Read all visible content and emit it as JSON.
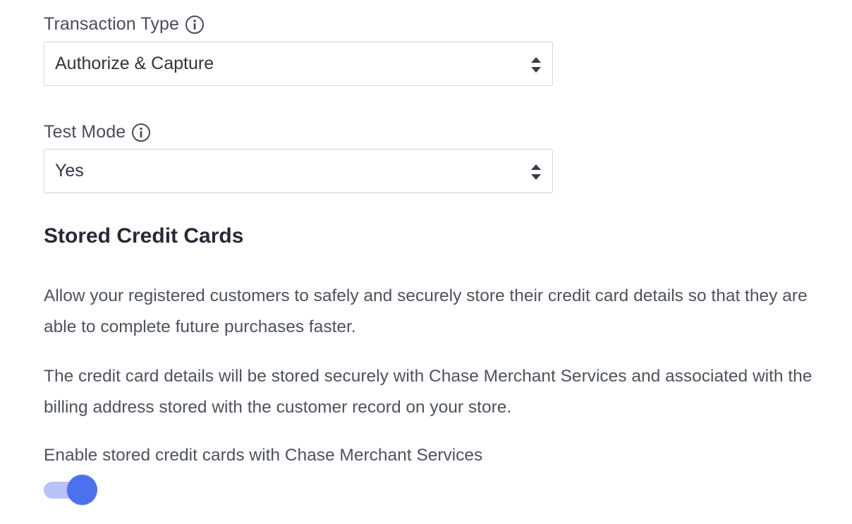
{
  "transaction_type": {
    "label": "Transaction Type",
    "selected": "Authorize & Capture"
  },
  "test_mode": {
    "label": "Test Mode",
    "selected": "Yes"
  },
  "stored_cards": {
    "title": "Stored Credit Cards",
    "paragraph1": "Allow your registered customers to safely and securely store their credit card details so that they are able to complete future purchases faster.",
    "paragraph2": "The credit card details will be stored securely with Chase Merchant Services and associated with the billing address stored with the customer record on your store.",
    "toggle_label": "Enable stored credit cards with Chase Merchant Services",
    "toggle_on": true
  },
  "colors": {
    "accent": "#4b71ec",
    "accent_track": "#b9c3f7",
    "text": "#4f525e",
    "border": "#d4d6dd"
  },
  "icons": {
    "info": "info-circle-icon",
    "select_arrows": "select-arrows-icon"
  }
}
